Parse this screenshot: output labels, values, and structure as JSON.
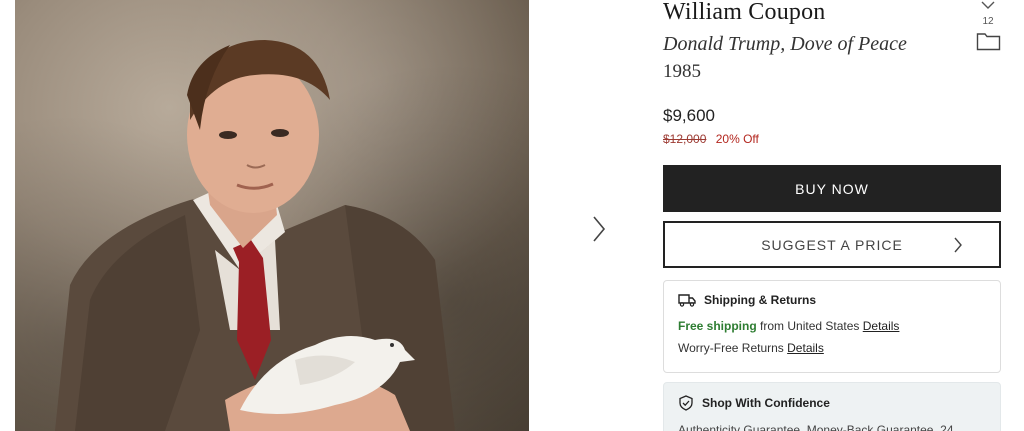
{
  "listing": {
    "artist": "William Coupon",
    "title": "Donald Trump, Dove of Peace",
    "year": "1985",
    "favorite_count": "12"
  },
  "pricing": {
    "price": "$9,600",
    "original_price": "$12,000",
    "discount": "20% Off"
  },
  "actions": {
    "buy_now": "BUY NOW",
    "suggest_price": "SUGGEST A PRICE"
  },
  "shipping": {
    "heading": "Shipping & Returns",
    "free_label": "Free shipping",
    "from_text": " from United States ",
    "details_link": "Details",
    "returns_text": "Worry-Free Returns ",
    "returns_details_link": "Details"
  },
  "confidence": {
    "heading": "Shop With Confidence",
    "text": "Authenticity Guarantee, Money-Back Guarantee, 24"
  },
  "icons": {
    "next": "chevron-right-icon",
    "favorite": "heart-icon",
    "folder": "folder-icon",
    "truck": "truck-icon",
    "shield": "shield-check-icon"
  },
  "colors": {
    "button_dark": "#222222",
    "discount_red": "#b3261e",
    "free_green": "#2e7d32",
    "confidence_bg": "#eef2f3"
  }
}
